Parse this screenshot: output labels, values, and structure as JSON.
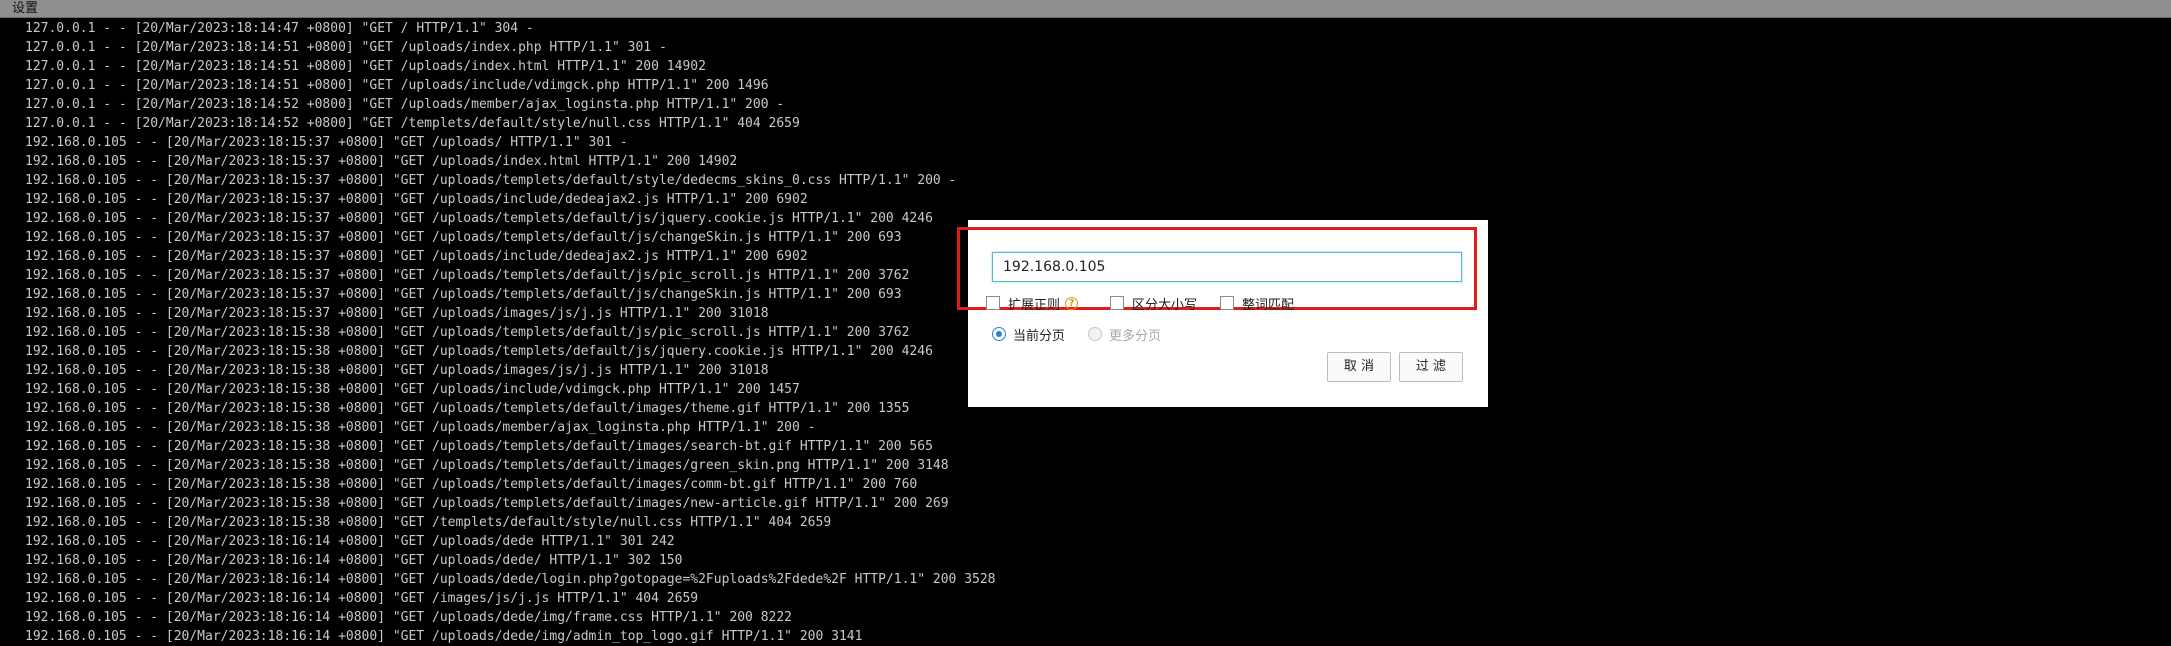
{
  "menubar": {
    "settings_label": "设置"
  },
  "log_lines": [
    "127.0.0.1 - - [20/Mar/2023:18:14:47 +0800] \"GET / HTTP/1.1\" 304 -",
    "127.0.0.1 - - [20/Mar/2023:18:14:51 +0800] \"GET /uploads/index.php HTTP/1.1\" 301 -",
    "127.0.0.1 - - [20/Mar/2023:18:14:51 +0800] \"GET /uploads/index.html HTTP/1.1\" 200 14902",
    "127.0.0.1 - - [20/Mar/2023:18:14:51 +0800] \"GET /uploads/include/vdimgck.php HTTP/1.1\" 200 1496",
    "127.0.0.1 - - [20/Mar/2023:18:14:52 +0800] \"GET /uploads/member/ajax_loginsta.php HTTP/1.1\" 200 -",
    "127.0.0.1 - - [20/Mar/2023:18:14:52 +0800] \"GET /templets/default/style/null.css HTTP/1.1\" 404 2659",
    "192.168.0.105 - - [20/Mar/2023:18:15:37 +0800] \"GET /uploads/ HTTP/1.1\" 301 -",
    "192.168.0.105 - - [20/Mar/2023:18:15:37 +0800] \"GET /uploads/index.html HTTP/1.1\" 200 14902",
    "192.168.0.105 - - [20/Mar/2023:18:15:37 +0800] \"GET /uploads/templets/default/style/dedecms_skins_0.css HTTP/1.1\" 200 -",
    "192.168.0.105 - - [20/Mar/2023:18:15:37 +0800] \"GET /uploads/include/dedeajax2.js HTTP/1.1\" 200 6902",
    "192.168.0.105 - - [20/Mar/2023:18:15:37 +0800] \"GET /uploads/templets/default/js/jquery.cookie.js HTTP/1.1\" 200 4246",
    "192.168.0.105 - - [20/Mar/2023:18:15:37 +0800] \"GET /uploads/templets/default/js/changeSkin.js HTTP/1.1\" 200 693",
    "192.168.0.105 - - [20/Mar/2023:18:15:37 +0800] \"GET /uploads/include/dedeajax2.js HTTP/1.1\" 200 6902",
    "192.168.0.105 - - [20/Mar/2023:18:15:37 +0800] \"GET /uploads/templets/default/js/pic_scroll.js HTTP/1.1\" 200 3762",
    "192.168.0.105 - - [20/Mar/2023:18:15:37 +0800] \"GET /uploads/templets/default/js/changeSkin.js HTTP/1.1\" 200 693",
    "192.168.0.105 - - [20/Mar/2023:18:15:37 +0800] \"GET /uploads/images/js/j.js HTTP/1.1\" 200 31018",
    "192.168.0.105 - - [20/Mar/2023:18:15:38 +0800] \"GET /uploads/templets/default/js/pic_scroll.js HTTP/1.1\" 200 3762",
    "192.168.0.105 - - [20/Mar/2023:18:15:38 +0800] \"GET /uploads/templets/default/js/jquery.cookie.js HTTP/1.1\" 200 4246",
    "192.168.0.105 - - [20/Mar/2023:18:15:38 +0800] \"GET /uploads/images/js/j.js HTTP/1.1\" 200 31018",
    "192.168.0.105 - - [20/Mar/2023:18:15:38 +0800] \"GET /uploads/include/vdimgck.php HTTP/1.1\" 200 1457",
    "192.168.0.105 - - [20/Mar/2023:18:15:38 +0800] \"GET /uploads/templets/default/images/theme.gif HTTP/1.1\" 200 1355",
    "192.168.0.105 - - [20/Mar/2023:18:15:38 +0800] \"GET /uploads/member/ajax_loginsta.php HTTP/1.1\" 200 -",
    "192.168.0.105 - - [20/Mar/2023:18:15:38 +0800] \"GET /uploads/templets/default/images/search-bt.gif HTTP/1.1\" 200 565",
    "192.168.0.105 - - [20/Mar/2023:18:15:38 +0800] \"GET /uploads/templets/default/images/green_skin.png HTTP/1.1\" 200 3148",
    "192.168.0.105 - - [20/Mar/2023:18:15:38 +0800] \"GET /uploads/templets/default/images/comm-bt.gif HTTP/1.1\" 200 760",
    "192.168.0.105 - - [20/Mar/2023:18:15:38 +0800] \"GET /uploads/templets/default/images/new-article.gif HTTP/1.1\" 200 269",
    "192.168.0.105 - - [20/Mar/2023:18:15:38 +0800] \"GET /templets/default/style/null.css HTTP/1.1\" 404 2659",
    "192.168.0.105 - - [20/Mar/2023:18:16:14 +0800] \"GET /uploads/dede HTTP/1.1\" 301 242",
    "192.168.0.105 - - [20/Mar/2023:18:16:14 +0800] \"GET /uploads/dede/ HTTP/1.1\" 302 150",
    "192.168.0.105 - - [20/Mar/2023:18:16:14 +0800] \"GET /uploads/dede/login.php?gotopage=%2Fuploads%2Fdede%2F HTTP/1.1\" 200 3528",
    "192.168.0.105 - - [20/Mar/2023:18:16:14 +0800] \"GET /images/js/j.js HTTP/1.1\" 404 2659",
    "192.168.0.105 - - [20/Mar/2023:18:16:14 +0800] \"GET /uploads/dede/img/frame.css HTTP/1.1\" 200 8222",
    "192.168.0.105 - - [20/Mar/2023:18:16:14 +0800] \"GET /uploads/dede/img/admin_top_logo.gif HTTP/1.1\" 200 3141"
  ],
  "filter_dialog": {
    "input_value": "192.168.0.105",
    "options": {
      "regex_label": "扩展正则",
      "regex_checked": false,
      "case_label": "区分大小写",
      "case_checked": false,
      "whole_word_label": "整词匹配",
      "whole_word_checked": false
    },
    "scope": {
      "current_label": "当前分页",
      "current_selected": true,
      "more_label": "更多分页",
      "more_disabled": true
    },
    "help_icon_glyph": "?",
    "cancel_label": "取 消",
    "filter_label": "过 滤",
    "highlight_color": "#e41b1b",
    "accent_color": "#2f7fd6"
  }
}
